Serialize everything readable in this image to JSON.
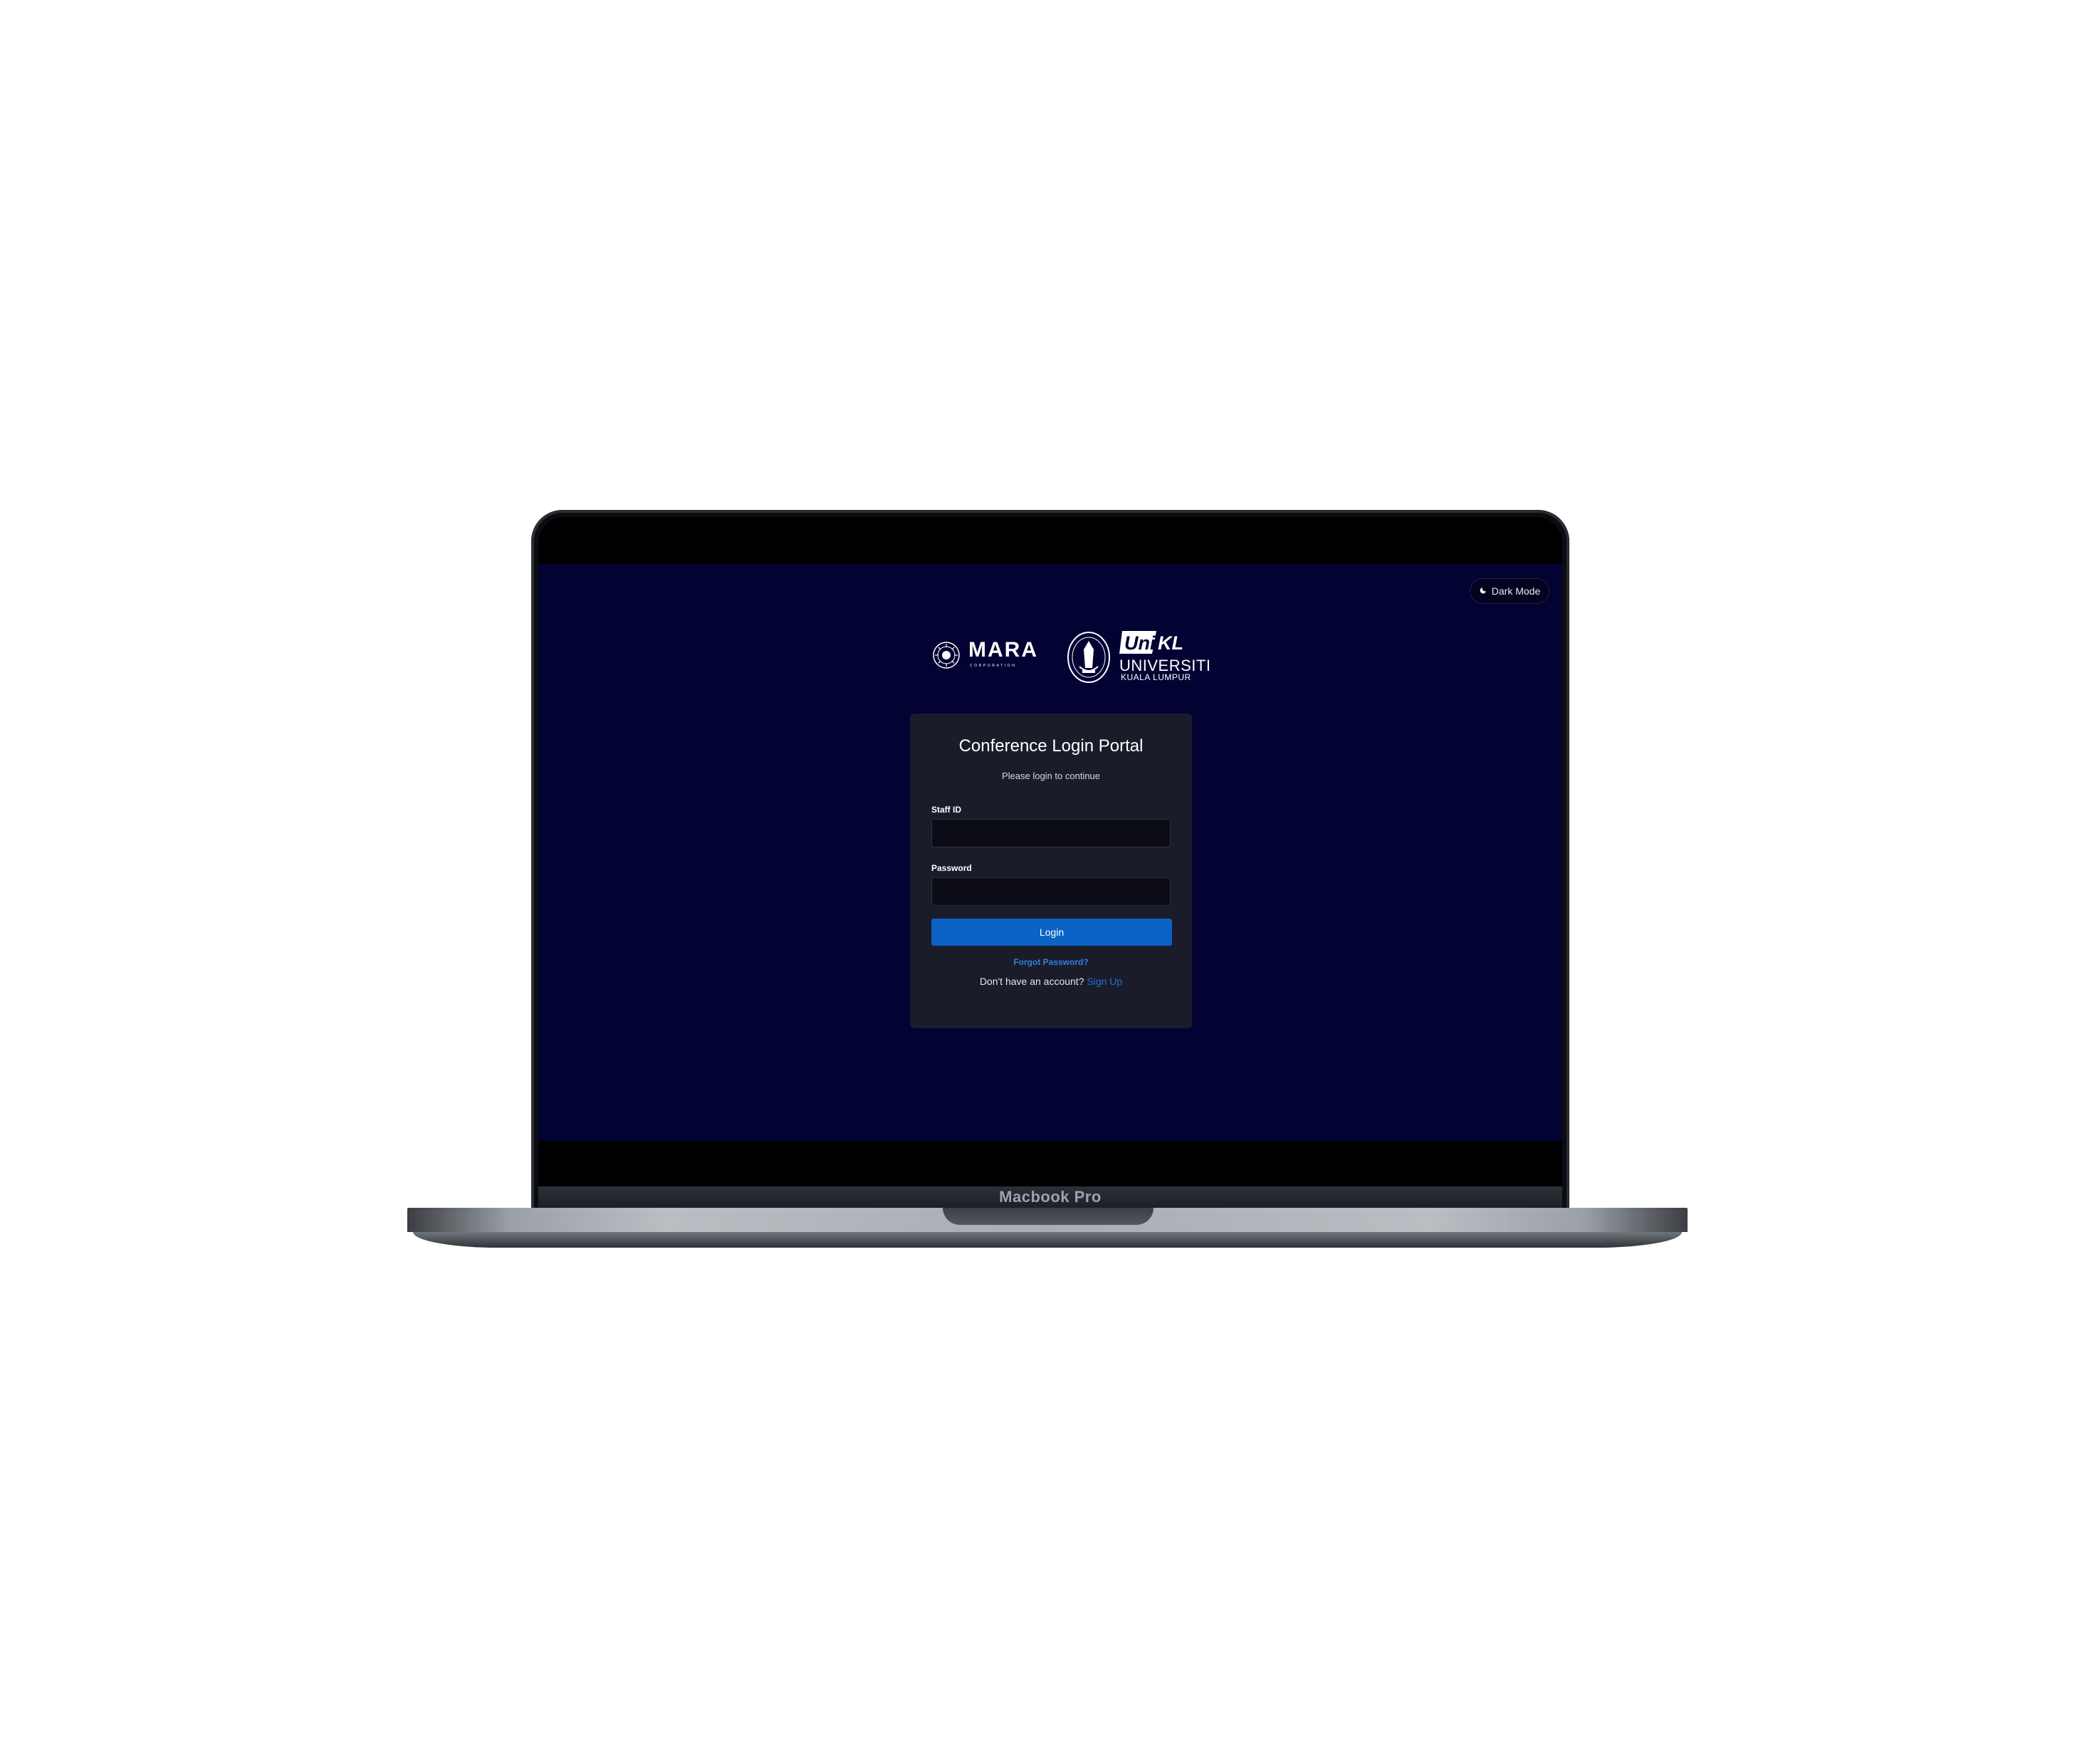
{
  "device": {
    "label": "Macbook Pro"
  },
  "header": {
    "dark_mode_label": "Dark Mode"
  },
  "logos": {
    "mara_word": "MARA",
    "mara_sub": "CORPORATION",
    "unikl_badge": "UniKL",
    "unikl_line1": "UNIVERSITI",
    "unikl_line2": "KUALA LUMPUR"
  },
  "login": {
    "title": "Conference Login Portal",
    "subtitle": "Please login to continue",
    "staff_id_label": "Staff ID",
    "staff_id_value": "",
    "password_label": "Password",
    "password_value": "",
    "login_button": "Login",
    "forgot_password": "Forgot Password?",
    "no_account_text": "Don't have an account?",
    "signup_link": "Sign Up"
  },
  "colors": {
    "screen_bg": "#020233",
    "card_bg": "#1b1c2a",
    "accent": "#0b63c6",
    "link": "#2f7fe0"
  }
}
